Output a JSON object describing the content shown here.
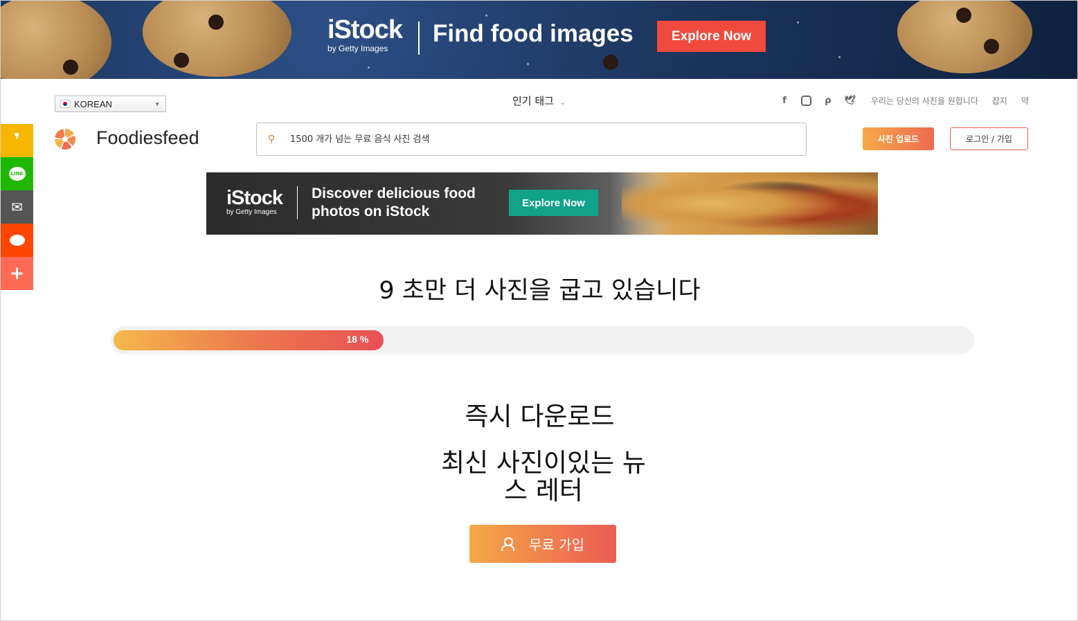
{
  "top_banner": {
    "brand": "iStock",
    "brand_sub": "by Getty Images",
    "headline": "Find food images",
    "cta": "Explore Now",
    "cta_color": "#f04a3f"
  },
  "share_bar": {
    "items": [
      {
        "name": "kakaostory",
        "color": "#f7b600",
        "glyph": "❜"
      },
      {
        "name": "line",
        "color": "#1fb800",
        "glyph": "LINE"
      },
      {
        "name": "mail",
        "color": "#555555",
        "glyph": "✉"
      },
      {
        "name": "reddit",
        "color": "#ff4500",
        "glyph": "●"
      },
      {
        "name": "more",
        "color": "#ff6a55",
        "glyph": "+"
      }
    ]
  },
  "header": {
    "language": "KOREAN",
    "popular_tags": "인기 태그",
    "site_name": "Foodiesfeed",
    "search_placeholder": "1500 개가 넘는 무료 음식 사진 검색",
    "nav_links": [
      "우리는 당신의 사진을 원합니다",
      "잡지",
      "약"
    ],
    "upload_label": "사진 업로드",
    "login_label": "로그인 / 가입"
  },
  "mid_banner": {
    "brand": "iStock",
    "brand_sub": "by Getty Images",
    "headline_line1": "Discover delicious food",
    "headline_line2": "photos on iStock",
    "cta": "Explore Now",
    "cta_color": "#11a38a"
  },
  "main": {
    "baking_title": "9 초만 더 사진을 굽고 있습니다",
    "progress_percent": 18,
    "progress_label": "18 %",
    "instant_download": "즉시 다운로드",
    "newsletter_line1": "최신 사진이있는 뉴",
    "newsletter_line2": "스 레터",
    "signup_label": "무료 가입"
  }
}
